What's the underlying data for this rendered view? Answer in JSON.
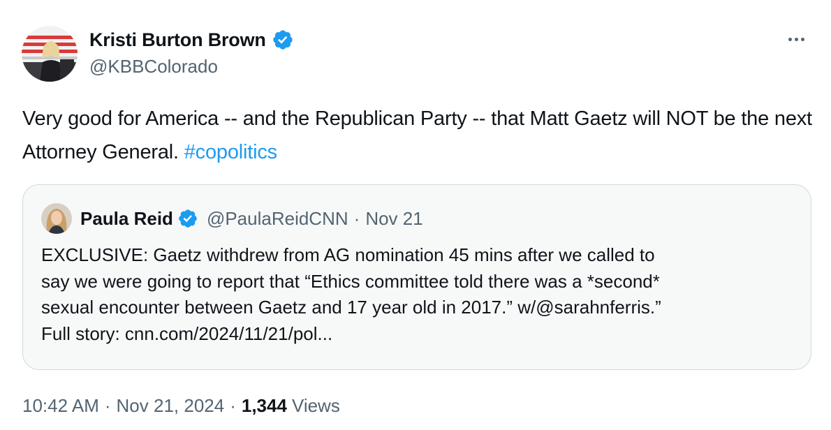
{
  "author": {
    "display_name": "Kristi Burton Brown",
    "handle": "@KBBColorado",
    "verified": true,
    "avatar_icon": "profile-photo"
  },
  "tweet": {
    "text_main": "Very good for America -- and the Republican Party -- that Matt Gaetz will NOT be the next Attorney General. ",
    "hashtag": "#copolitics"
  },
  "quote": {
    "display_name": "Paula Reid",
    "handle": "@PaulaReidCNN",
    "separator": "·",
    "date": "Nov 21",
    "verified": true,
    "lines": [
      "EXCLUSIVE: Gaetz withdrew from AG nomination 45 mins after we called to",
      "say we were going to report that “Ethics committee told there was a *second*",
      "sexual encounter between Gaetz and 17 year old in 2017.” w/@sarahnferris.”",
      "Full story: cnn.com/2024/11/21/pol..."
    ]
  },
  "meta": {
    "time": "10:42 AM",
    "sep1": "·",
    "date": "Nov 21, 2024",
    "sep2": "·",
    "views_count": "1,344",
    "views_label": "Views"
  },
  "colors": {
    "link": "#1d9bf0",
    "secondary_text": "#536471",
    "primary_text": "#0f1419",
    "card_border": "#cfd9de",
    "card_bg": "#f7f9f9"
  }
}
